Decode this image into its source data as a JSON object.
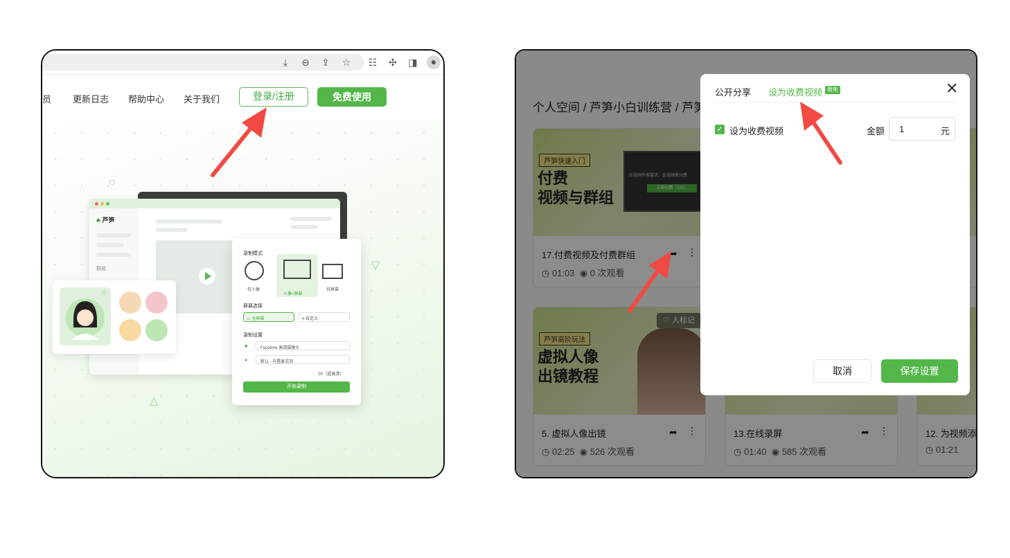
{
  "left": {
    "nav": {
      "partial_item": "员",
      "changelog": "更新日志",
      "help": "帮助中心",
      "about": "关于我们",
      "login": "登录/注册",
      "free": "免费使用"
    },
    "app": {
      "logo": "芦笋",
      "group_label": "群组"
    },
    "record_panel": {
      "mode_label": "录制模式",
      "mode_portrait": "仅人像",
      "mode_both": "人像+屏幕",
      "mode_screen": "仅屏幕",
      "screen_label": "屏幕选择",
      "screen_full": "全屏幕",
      "screen_custom": "自定义",
      "settings_label": "录制设置",
      "camera": "Facetime 高清摄像头",
      "mic": "默认 - 内置麦克风",
      "quality": "2K（超高清）",
      "start": "开始录制"
    }
  },
  "right": {
    "breadcrumb": "个人空间 / 芦笋小白训练营 / 芦笋",
    "cards": [
      {
        "tag": "芦笋快速入门",
        "thumb_title": "付费\n视频与群组",
        "title": "17.付费视频及付费群组",
        "duration": "01:03",
        "views": "0 次观看",
        "inner_text": "应视频作者要求，此视频需付费",
        "inner_btn": "立即付费（1元）"
      },
      {
        "tag": "芦笋高阶玩法",
        "thumb_title": "虚拟人像\n出镜教程",
        "title": "5. 虚拟人像出镜",
        "duration": "02:25",
        "views": "526 次观看",
        "mark": "人标记"
      },
      {
        "title": "13.在线录屏",
        "duration": "01:40",
        "views": "585 次观看"
      },
      {
        "title": "12. 为视频添",
        "duration": "01:21"
      }
    ],
    "modal": {
      "tab_public": "公开分享",
      "tab_paid": "设为收费视频",
      "badge": "限免",
      "checkbox_label": "设为收费视频",
      "amount_label": "金额",
      "amount_value": "1",
      "amount_unit": "元",
      "cancel": "取消",
      "save": "保存设置"
    }
  },
  "colors": {
    "brand_green": "#52b748",
    "arrow_red": "#f04a43"
  }
}
